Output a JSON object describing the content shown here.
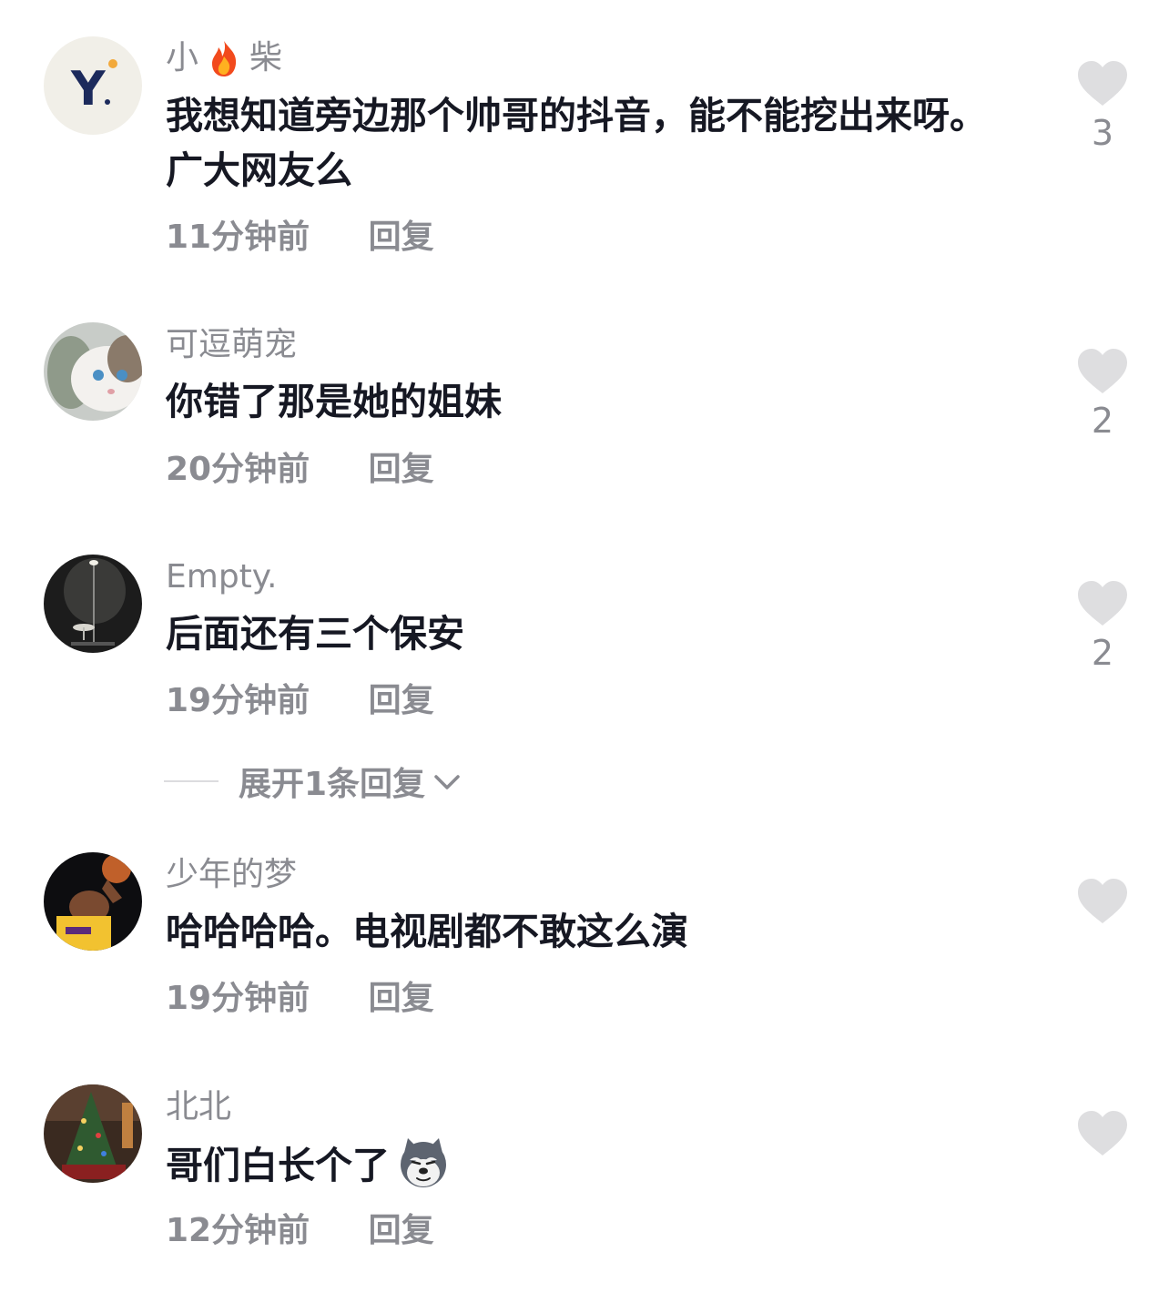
{
  "comments": [
    {
      "username_prefix": "小",
      "username_suffix": "柴",
      "text": "我想知道旁边那个帅哥的抖音，能不能挖出来呀。广大网友么",
      "time": "11分钟前",
      "reply_label": "回复",
      "like_count": "3"
    },
    {
      "username": "可逗萌宠",
      "text": "你错了那是她的姐妹",
      "time": "20分钟前",
      "reply_label": "回复",
      "like_count": "2"
    },
    {
      "username": "Empty.",
      "text": "后面还有三个保安",
      "time": "19分钟前",
      "reply_label": "回复",
      "like_count": "2"
    },
    {
      "username": "少年的梦",
      "text": "哈哈哈哈。电视剧都不敢这么演",
      "time": "19分钟前",
      "reply_label": "回复",
      "like_count": ""
    },
    {
      "username": "北北",
      "text": "哥们白长个了",
      "time": "12分钟前",
      "reply_label": "回复",
      "like_count": ""
    }
  ],
  "expand_replies_label": "展开1条回复",
  "icons": {
    "like": "heart-icon",
    "expand": "chevron-down-icon",
    "username_emoji": "fire-emoji",
    "inline_emoji": "husky-emoji"
  },
  "colors": {
    "text_primary": "#161823",
    "text_secondary": "#8a8b91",
    "heart": "#dedee0"
  }
}
